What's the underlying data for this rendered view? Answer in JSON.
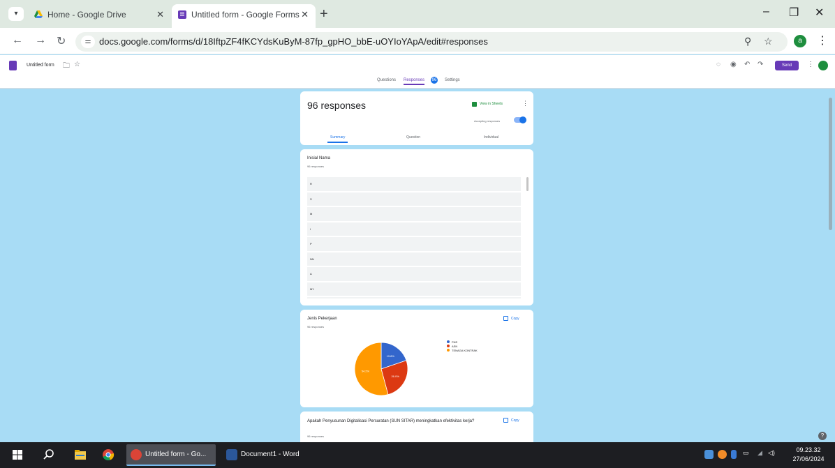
{
  "browser": {
    "tabs": [
      {
        "title": "Home - Google Drive",
        "active": false
      },
      {
        "title": "Untitled form - Google Forms",
        "active": true
      }
    ],
    "url": "docs.google.com/forms/d/18IftpZF4fKCYdsKuByM-87fp_gpHO_bbE-uOYIoYApA/edit#responses",
    "profile_initial": "a"
  },
  "form": {
    "title": "Untitled form",
    "send_label": "Send",
    "tabs": [
      "Questions",
      "Responses",
      "Settings"
    ],
    "responses_badge": "96"
  },
  "summary": {
    "count_label": "96 responses",
    "sheets_label": "View in Sheets",
    "accepting_label": "Accepting responses",
    "subtabs": [
      "Summary",
      "Question",
      "Individual"
    ]
  },
  "q1": {
    "title": "Inisial Nama",
    "responses": "96 responses",
    "answers": [
      "R",
      "S",
      "M",
      "I",
      "P",
      "NN",
      "A",
      "MY",
      "SS"
    ]
  },
  "q2": {
    "title": "Jenis Pekerjaan",
    "responses": "96 responses",
    "copy_label": "Copy"
  },
  "q3": {
    "title": "Apakah Penyusunan Digitalisasi Persuratan (SUN SITAR) meningkatkan efektivitas kerja?",
    "responses": "96 responses",
    "copy_label": "Copy"
  },
  "chart_data": {
    "type": "pie",
    "series": [
      {
        "name": "PNS",
        "value": 19.8,
        "label": "19.8%",
        "color": "#3366cc"
      },
      {
        "name": "ASN",
        "value": 26.0,
        "label": "26.0%",
        "color": "#dc3912"
      },
      {
        "name": "TENAGA KONTRAK",
        "value": 54.2,
        "label": "54.2%",
        "color": "#ff9900"
      }
    ]
  },
  "taskbar": {
    "apps": [
      "Untitled form - Go...",
      "Document1 - Word"
    ],
    "time": "09.23.32",
    "date": "27/06/2024"
  }
}
